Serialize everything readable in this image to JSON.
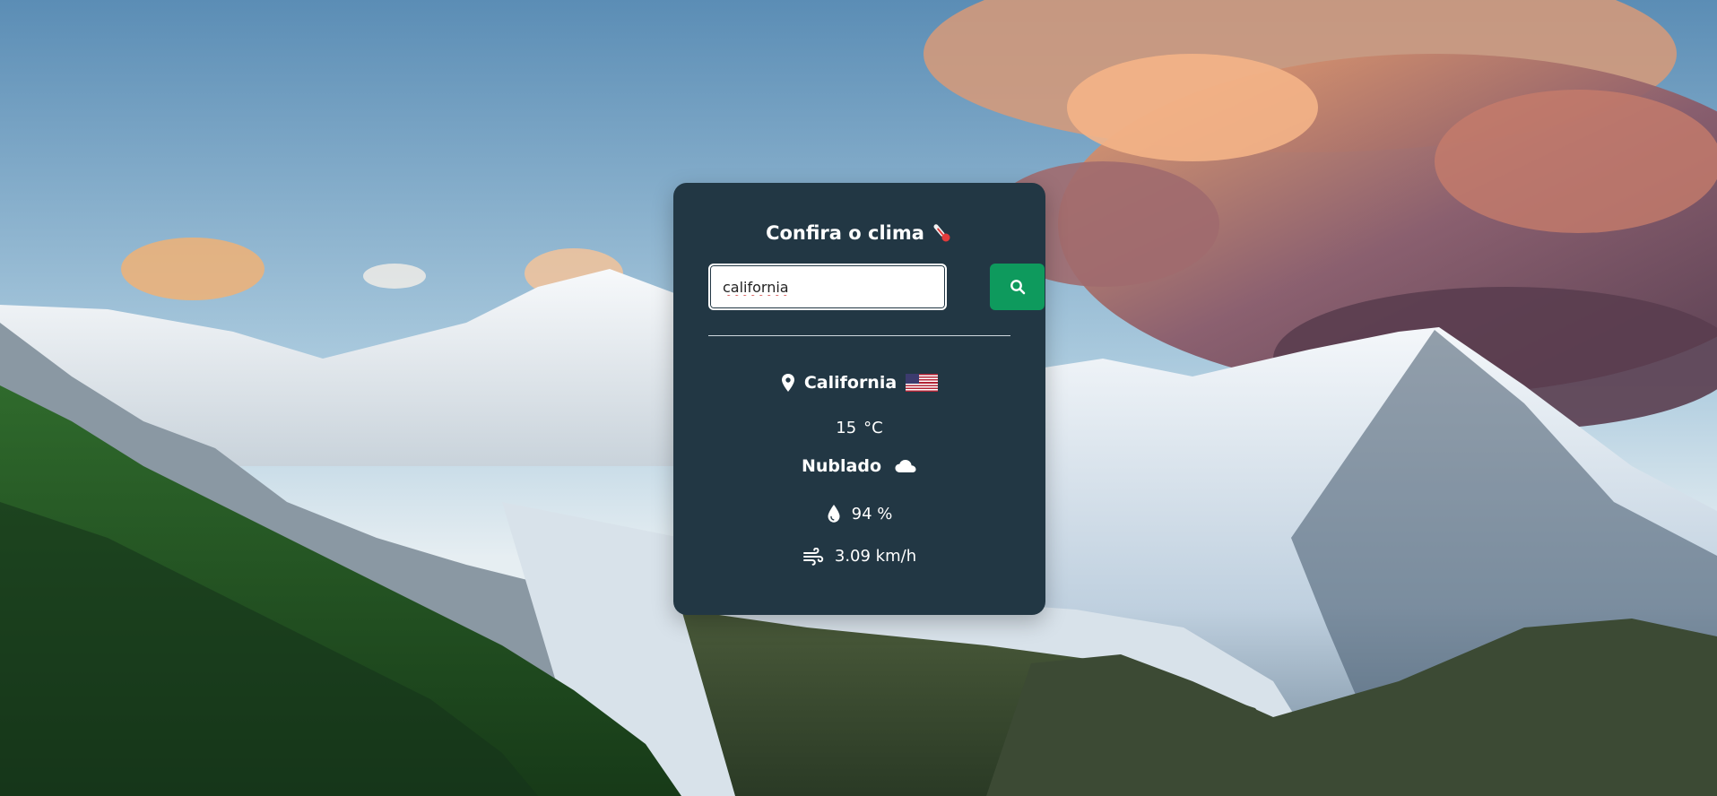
{
  "background": {
    "sky_top": "#5e8fb6",
    "sky_bottom": "#cfe3ef",
    "snow": "#eef3f7",
    "rock": "#4c5a63",
    "forest": "#1f4b23",
    "cloud_orange": "#f4a46a"
  },
  "card": {
    "title": "Confira o clima",
    "title_icon": "thermometer-icon",
    "accent": "#0e9a5d",
    "background": "#223744"
  },
  "search": {
    "value": "california",
    "button_icon": "search-icon"
  },
  "weather": {
    "city": "California",
    "location_icon": "map-pin-icon",
    "country_flag": "us-flag-icon",
    "temperature": "15",
    "temp_unit": "°C",
    "condition": "Nublado",
    "condition_icon": "cloud-icon",
    "humidity": "94 %",
    "humidity_icon": "droplet-icon",
    "wind": "3.09 km/h",
    "wind_icon": "wind-icon"
  }
}
